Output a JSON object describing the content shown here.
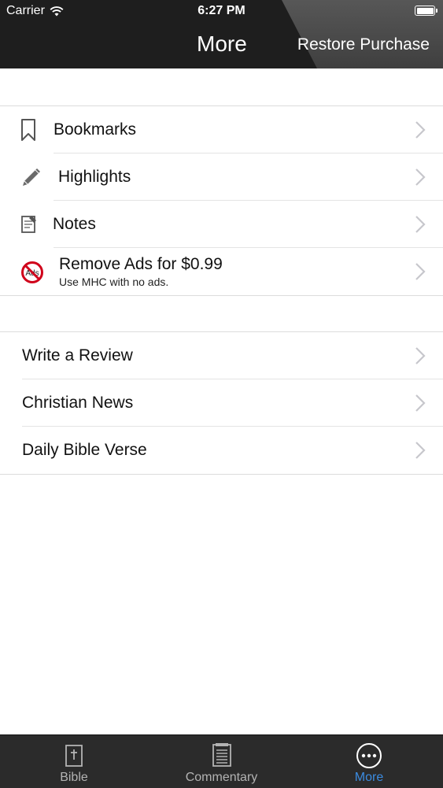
{
  "status_bar": {
    "carrier": "Carrier",
    "time": "6:27 PM",
    "icons": [
      "wifi-icon",
      "battery-icon"
    ]
  },
  "nav": {
    "title": "More",
    "restore_label": "Restore Purchase"
  },
  "section1": {
    "items": [
      {
        "label": "Bookmarks",
        "icon": "bookmark-icon"
      },
      {
        "label": "Highlights",
        "icon": "pencil-icon"
      },
      {
        "label": "Notes",
        "icon": "notes-icon"
      },
      {
        "label": "Remove Ads for $0.99",
        "sublabel": "Use MHC with no ads.",
        "icon": "no-ads-icon",
        "icon_text": "Ads"
      }
    ]
  },
  "section2": {
    "items": [
      {
        "label": "Write a Review"
      },
      {
        "label": "Christian News"
      },
      {
        "label": "Daily Bible Verse"
      }
    ]
  },
  "tabbar": {
    "tabs": [
      {
        "label": "Bible",
        "icon": "bible-icon",
        "active": false
      },
      {
        "label": "Commentary",
        "icon": "commentary-icon",
        "active": false
      },
      {
        "label": "More",
        "icon": "more-icon",
        "active": true
      }
    ]
  },
  "colors": {
    "header_bg": "#1e1e1e",
    "active_tab": "#3b8be0",
    "inactive_tab": "#b3b3b3",
    "no_ads_red": "#d0021b",
    "chevron": "#c7c7cc"
  }
}
